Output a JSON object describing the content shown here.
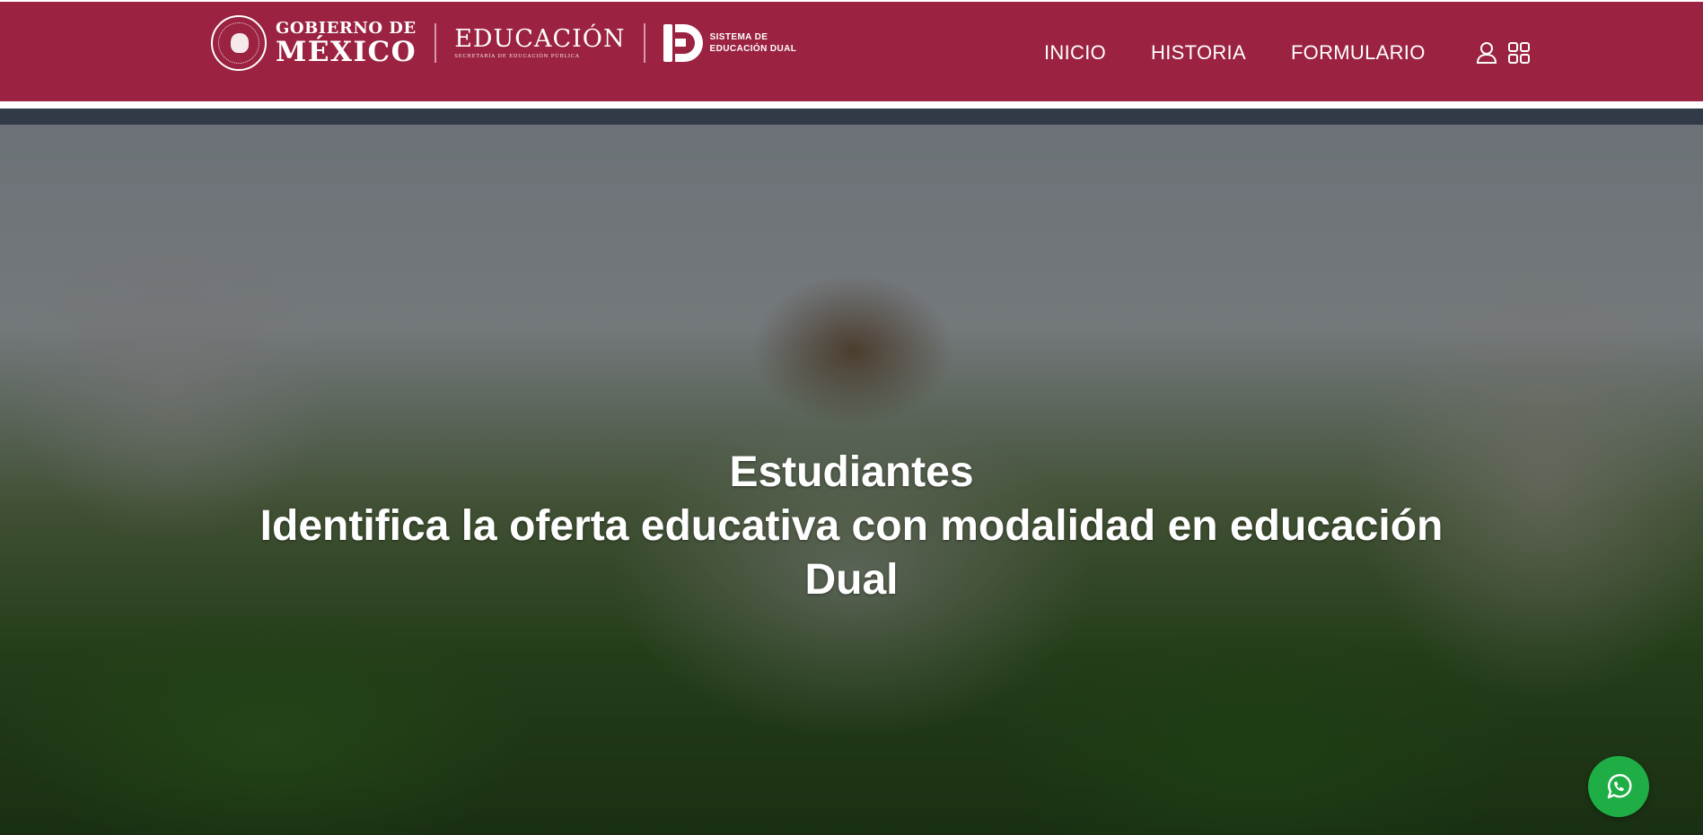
{
  "header": {
    "gobierno_line1": "GOBIERNO DE",
    "gobierno_line2": "MÉXICO",
    "educacion_title": "EDUCACIÓN",
    "educacion_subtitle": "SECRETARÍA DE EDUCACIÓN PÚBLICA",
    "sed_line1": "SISTEMA DE",
    "sed_line2": "EDUCACIÓN DUAL",
    "brand_color": "#9b2240"
  },
  "nav": {
    "items": [
      {
        "label": "INICIO"
      },
      {
        "label": "HISTORIA"
      },
      {
        "label": "FORMULARIO"
      }
    ],
    "icons": [
      "user-icon",
      "grid-apps-icon"
    ]
  },
  "hero": {
    "title": "Estudiantes",
    "subtitle": "Identifica la oferta educativa con modalidad en educación Dual"
  },
  "floating": {
    "whatsapp_icon": "whatsapp-icon",
    "whatsapp_color": "#1fae45"
  }
}
